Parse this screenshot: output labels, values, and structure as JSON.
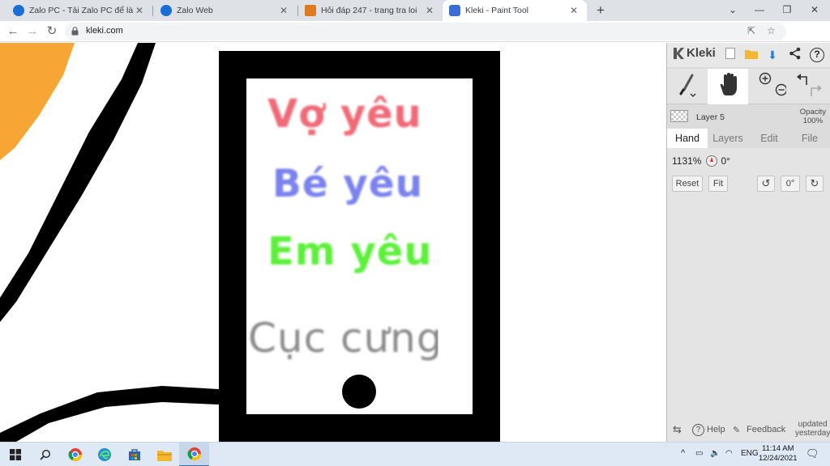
{
  "browser": {
    "tabs": [
      {
        "title": "Zalo PC - Tải Zalo PC để làm việc",
        "favicon_color": "#1b6ed6",
        "active": false
      },
      {
        "title": "Zalo Web",
        "favicon_color": "#1b6ed6",
        "active": false
      },
      {
        "title": "Hỏi đáp 247 - trang tra loi",
        "favicon_color": "#e07b1d",
        "active": false
      },
      {
        "title": "Kleki - Paint Tool",
        "favicon_color": "#3b6bd6",
        "active": true
      }
    ],
    "url": "kleki.com"
  },
  "canvas": {
    "texts": [
      {
        "text": "Vợ yêu",
        "color": "#f06a78"
      },
      {
        "text": "Bé yêu",
        "color": "#7a82ee"
      },
      {
        "text": "Em yêu",
        "color": "#5cf03a"
      },
      {
        "text": "Cục cưng",
        "color": "#8a8a8a"
      }
    ],
    "colors": {
      "orange": "#f7a534",
      "ink": "#000000",
      "paper": "#ffffff"
    }
  },
  "panel": {
    "logo": "Kleki",
    "layer_name": "Layer 5",
    "opacity_label": "Opacity",
    "opacity_value": "100%",
    "tabs": [
      "Hand",
      "Layers",
      "Edit",
      "File"
    ],
    "zoom": "1131%",
    "rotation": "0°",
    "buttons": {
      "reset": "Reset",
      "fit": "Fit",
      "angle": "0°"
    },
    "bottom": {
      "help": "Help",
      "feedback": "Feedback",
      "updated_line1": "updated",
      "updated_line2": "yesterday"
    }
  },
  "taskbar": {
    "language": "ENG",
    "time": "11:14 AM",
    "date": "12/24/2021"
  }
}
